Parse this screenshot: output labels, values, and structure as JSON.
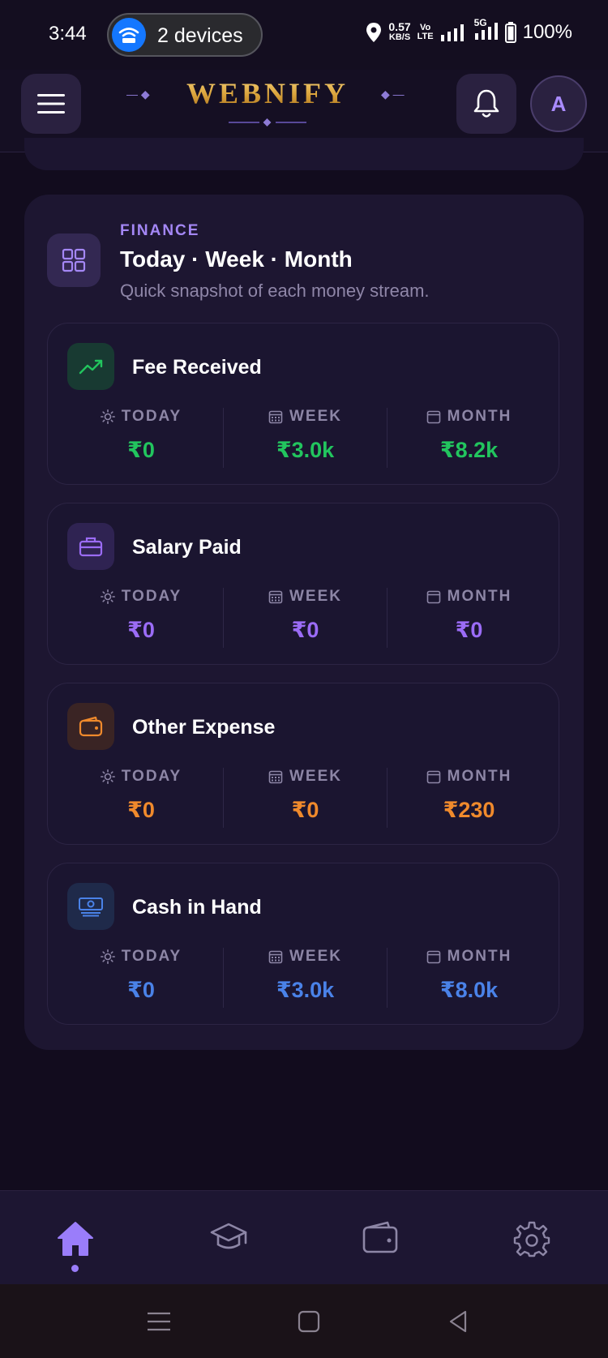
{
  "status_bar": {
    "time": "3:44",
    "pill_text": "2 devices",
    "net_speed_value": "0.57",
    "net_speed_unit": "KB/S",
    "volte_top": "Vo",
    "volte_bottom": "LTE",
    "fiveg_label": "5G",
    "battery": "100%"
  },
  "header": {
    "brand": "WEBNIFY",
    "menu_icon": "hamburger-icon",
    "bell_icon": "bell-icon",
    "avatar_letter": "A"
  },
  "finance": {
    "eyebrow": "FINANCE",
    "title": "Today · Week · Month",
    "subtitle": "Quick snapshot of each money stream.",
    "panel_icon": "grid-icon",
    "labels": {
      "today": "TODAY",
      "week": "WEEK",
      "month": "MONTH"
    },
    "cards": [
      {
        "title": "Fee Received",
        "icon": "trending-up-icon",
        "color": "#22c55e",
        "icon_bg": "#183a32",
        "today": "₹0",
        "week": "₹3.0k",
        "month": "₹8.2k"
      },
      {
        "title": "Salary Paid",
        "icon": "briefcase-icon",
        "color": "#9b6cf6",
        "icon_bg": "#2f2352",
        "today": "₹0",
        "week": "₹0",
        "month": "₹0"
      },
      {
        "title": "Other Expense",
        "icon": "wallet-icon",
        "color": "#f08a2c",
        "icon_bg": "#3a2424",
        "today": "₹0",
        "week": "₹0",
        "month": "₹230"
      },
      {
        "title": "Cash in Hand",
        "icon": "banknote-icon",
        "color": "#4a82e8",
        "icon_bg": "#1f2a4a",
        "today": "₹0",
        "week": "₹3.0k",
        "month": "₹8.0k"
      }
    ]
  },
  "bottom_nav": {
    "items": [
      "home-icon",
      "graduation-cap-icon",
      "wallet-icon",
      "settings-icon"
    ],
    "active": "home-icon",
    "accent": "#9a7dfa"
  }
}
